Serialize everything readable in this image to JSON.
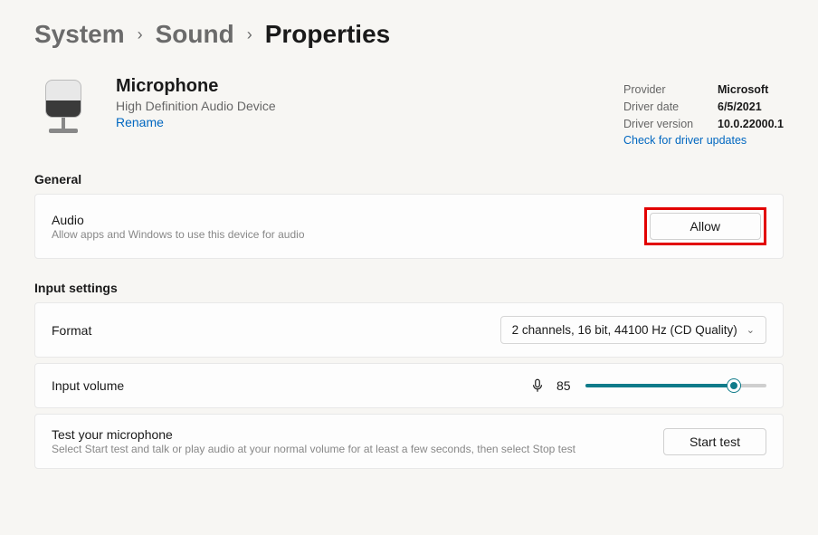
{
  "breadcrumb": {
    "items": [
      "System",
      "Sound",
      "Properties"
    ]
  },
  "device": {
    "title": "Microphone",
    "subtitle": "High Definition Audio Device",
    "rename": "Rename"
  },
  "driver": {
    "provider_label": "Provider",
    "provider_value": "Microsoft",
    "date_label": "Driver date",
    "date_value": "6/5/2021",
    "version_label": "Driver version",
    "version_value": "10.0.22000.1",
    "update_link": "Check for driver updates"
  },
  "sections": {
    "general": "General",
    "input_settings": "Input settings"
  },
  "audio_card": {
    "title": "Audio",
    "subtitle": "Allow apps and Windows to use this device for audio",
    "button": "Allow"
  },
  "format_card": {
    "title": "Format",
    "selected": "2 channels, 16 bit, 44100 Hz (CD Quality)"
  },
  "volume_card": {
    "title": "Input volume",
    "value": "85",
    "percent": 82
  },
  "test_card": {
    "title": "Test your microphone",
    "subtitle": "Select Start test and talk or play audio at your normal volume for at least a few seconds, then select Stop test",
    "button": "Start test"
  }
}
